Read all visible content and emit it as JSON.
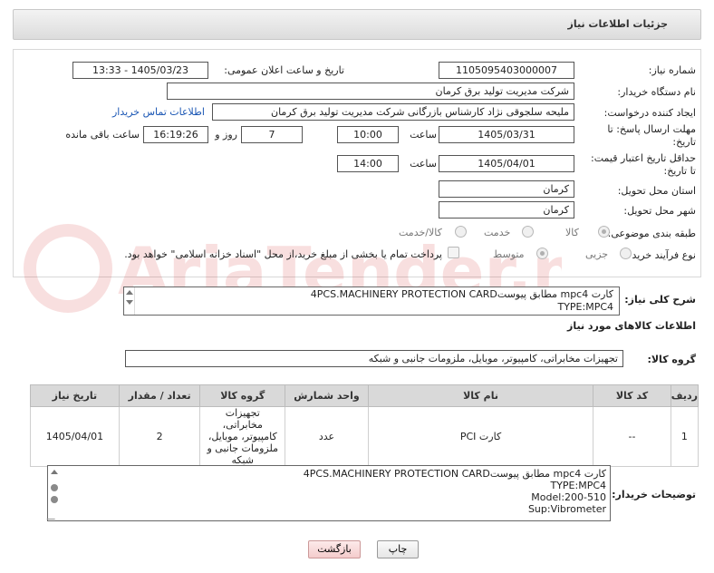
{
  "header": {
    "title": "جزئیات اطلاعات نیاز"
  },
  "form": {
    "need_number_label": "شماره نیاز:",
    "need_number": "1105095403000007",
    "announce_label": "تاریخ و ساعت اعلان عمومی:",
    "announce_value": "1405/03/23 - 13:33",
    "buyer_org_label": "نام دستگاه خریدار:",
    "buyer_org": "شرکت مدیریت تولید برق کرمان",
    "creator_label": "ایجاد کننده درخواست:",
    "creator": "ملیحه سلجوقی نژاد کارشناس بازرگانی شرکت مدیریت تولید برق کرمان",
    "contact_link": "اطلاعات تماس خریدار",
    "reply_deadline_label_1": "مهلت ارسال پاسخ: تا",
    "reply_deadline_label_2": "تاریخ:",
    "reply_date": "1405/03/31",
    "time_label": "ساعت",
    "reply_time": "10:00",
    "days_value": "7",
    "days_label": "روز و",
    "remaining_value": "16:19:26",
    "remaining_label": "ساعت باقی مانده",
    "validity_label_1": "حداقل تاریخ اعتبار قیمت:",
    "validity_label_2": "تا تاریخ:",
    "validity_date": "1405/04/01",
    "validity_time_label": "ساعت",
    "validity_time": "14:00",
    "province_label": "استان محل تحویل:",
    "province": "کرمان",
    "city_label": "شهر محل تحویل:",
    "city": "کرمان",
    "category_label": "طبقه بندی موضوعی:",
    "category_options": [
      "کالا",
      "خدمت",
      "کالا/خدمت"
    ],
    "process_label": "نوع فرآیند خرید :",
    "process_options": [
      "جزیی",
      "متوسط"
    ],
    "payment_note": "پرداخت تمام یا بخشی از مبلغ خرید،از محل \"اسناد خزانه اسلامی\" خواهد بود."
  },
  "general_desc": {
    "label": "شرح کلی نیاز:",
    "lines": [
      "کارت mpc4 مطابق پیوست4PCS.MACHINERY PROTECTION CARD",
      "TYPE:MPC4"
    ]
  },
  "goods_info": {
    "title": "اطلاعات کالاهای مورد نیاز",
    "group_label": "گروه کالا:",
    "group_value": "تجهیزات مخابراتی، کامپیوتر، موبایل، ملزومات جانبی و شبکه"
  },
  "table": {
    "headers": [
      "ردیف",
      "کد کالا",
      "نام کالا",
      "واحد شمارش",
      "گروه کالا",
      "تعداد / مقدار",
      "تاریخ نیاز"
    ],
    "row": {
      "index": "1",
      "code": "--",
      "name": "کارت PCI",
      "unit": "عدد",
      "group": "تجهیزات مخابراتی، کامپیوتر، موبایل، ملزومات جانبی و شبکه",
      "qty": "2",
      "date": "1405/04/01"
    }
  },
  "buyer_notes": {
    "label": "توضیحات خریدار:",
    "lines": [
      "کارت mpc4 مطابق پیوست4PCS.MACHINERY PROTECTION CARD",
      "TYPE:MPC4",
      "Model:200-510",
      "Sup:Vibrometer"
    ]
  },
  "buttons": {
    "print": "چاپ",
    "back": "بازگشت"
  },
  "watermark": "AriaTender.net"
}
